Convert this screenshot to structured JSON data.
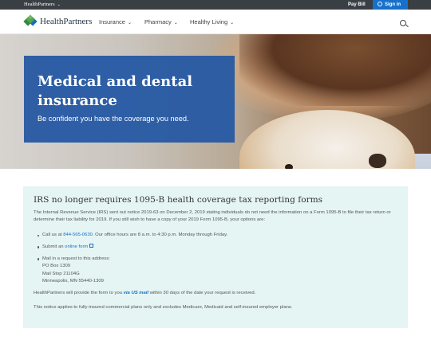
{
  "topbar": {
    "brand_switch": "HealthPartners",
    "pay_bill": "Pay Bill",
    "sign_in": "Sign in"
  },
  "nav": {
    "logo_text": "HealthPartners",
    "items": [
      {
        "label": "Insurance"
      },
      {
        "label": "Pharmacy"
      },
      {
        "label": "Healthy Living"
      }
    ]
  },
  "hero": {
    "title": "Medical and dental insurance",
    "subtitle": "Be confident you have the coverage you need."
  },
  "notice": {
    "heading": "IRS no longer requires 1095-B health coverage tax reporting forms",
    "intro": "The Internal Revenue Service (IRS) sent out notice 2019-63 on December 2, 2019 stating individuals do not need the information on a Form 1095-B to file their tax return or determine their tax liability for 2019. If you still wish to have a copy of your 2019 Form 1095-B, your options are:",
    "call_prefix": "Call us at ",
    "phone": "844-565-0630",
    "call_suffix": ". Our office hours are 8 a.m. to 4:30 p.m. Monday through Friday.",
    "submit_prefix": "Submit an ",
    "online_form": "online form",
    "mail_intro": "Mail in a request to this address:",
    "address": [
      "PO Box 1309",
      "Mail Stop 21104G",
      "Minneapolis, MN 55440-1309"
    ],
    "provide_prefix": "HealthPartners will provide the form to you ",
    "provide_emph": "via US mail",
    "provide_suffix": " within 30 days of the date your request is received.",
    "applies": "This notice applies to fully-insured commercial plans only and excludes Medicare, Medicaid and self-insured employer plans."
  },
  "colors": {
    "topbar": "#3a3f44",
    "signin": "#1770c9",
    "hero_panel": "#285aa3",
    "notice_bg": "#e5f5f4",
    "link": "#1770c9"
  },
  "icons": [
    "chevron-down-icon",
    "person-icon",
    "search-icon",
    "external-link-icon"
  ]
}
